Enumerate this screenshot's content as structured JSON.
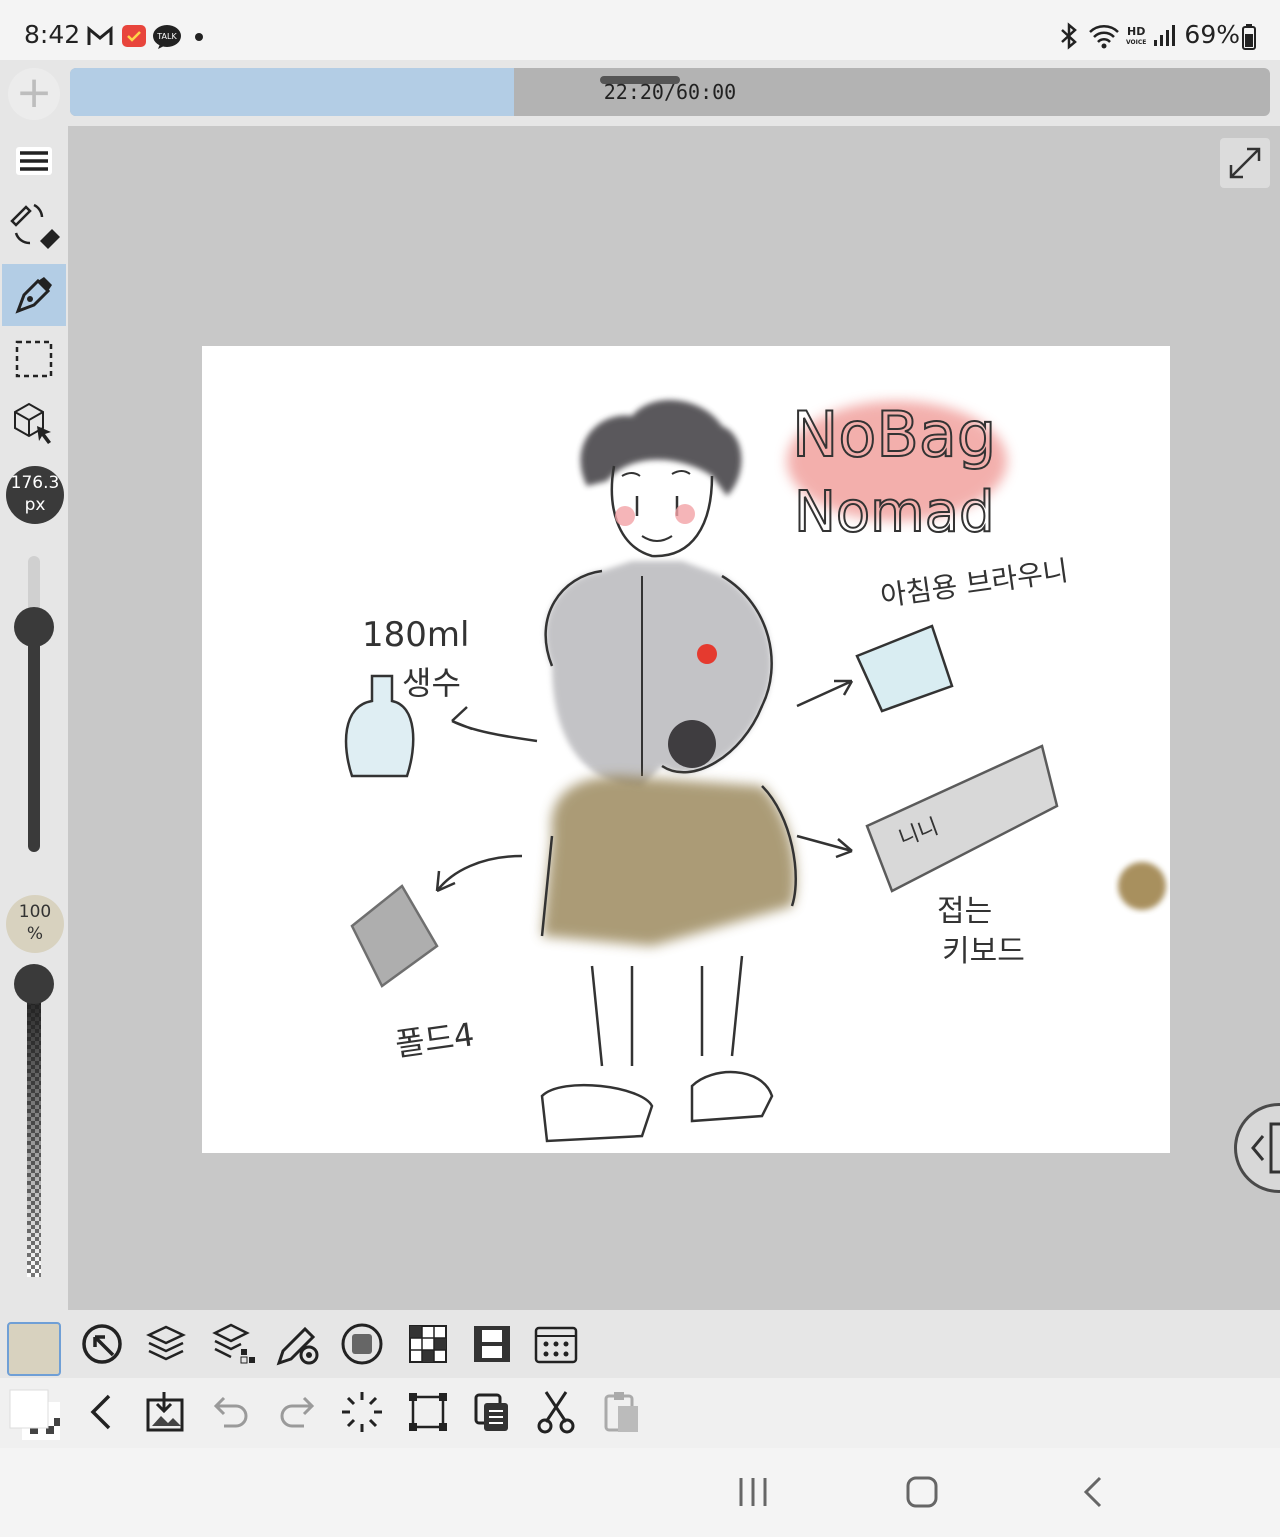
{
  "status_bar": {
    "time": "8:42",
    "notification_icons": [
      "gmail-icon",
      "calendar-app-icon",
      "kakaotalk-icon",
      "dot-indicator"
    ],
    "kakao_label": "TALK",
    "hd_label": "HD",
    "voice_label": "VOICE",
    "battery_text": "69%"
  },
  "timeline": {
    "label": "22:20/60:00",
    "progress_fraction": 0.37
  },
  "left_toolbar": {
    "tools": [
      "menu-icon",
      "pen-eraser-toggle-icon",
      "pen-tool-icon",
      "selection-rect-icon",
      "transform-3d-icon"
    ],
    "active_tool": "pen-tool-icon",
    "brush_size": "176.3",
    "brush_unit": "px",
    "opacity_value": "100",
    "opacity_unit": "%"
  },
  "artwork": {
    "title_line1": "NoBag",
    "title_line2": "Nomad",
    "label_water": "180ml",
    "label_water2": "생수",
    "label_brownie": "아침용 브라우니",
    "label_keyboard1": "접는",
    "label_keyboard2": "키보드",
    "label_phone": "폴드4",
    "keyboard_keys": "니니"
  },
  "colors": {
    "primary": "#d8d2bf",
    "accent": "#b3cde5",
    "toolbar": "#e6e6e6",
    "canvas_bg": "#c8c8c8"
  },
  "bottom_toolbar_1": [
    "quick-access-icon",
    "layers-icon",
    "layer-properties-icon",
    "brush-settings-icon",
    "material-icon",
    "grid-icon",
    "filmstrip-icon",
    "calendar-grid-icon"
  ],
  "bottom_toolbar_2": [
    "back-icon",
    "save-icon",
    "undo-icon",
    "redo-icon",
    "loading-spinner-icon",
    "transform-icon",
    "copy-icon",
    "cut-icon",
    "paste-icon"
  ],
  "nav_bar": [
    "recent-apps-icon",
    "home-icon",
    "back-nav-icon"
  ]
}
